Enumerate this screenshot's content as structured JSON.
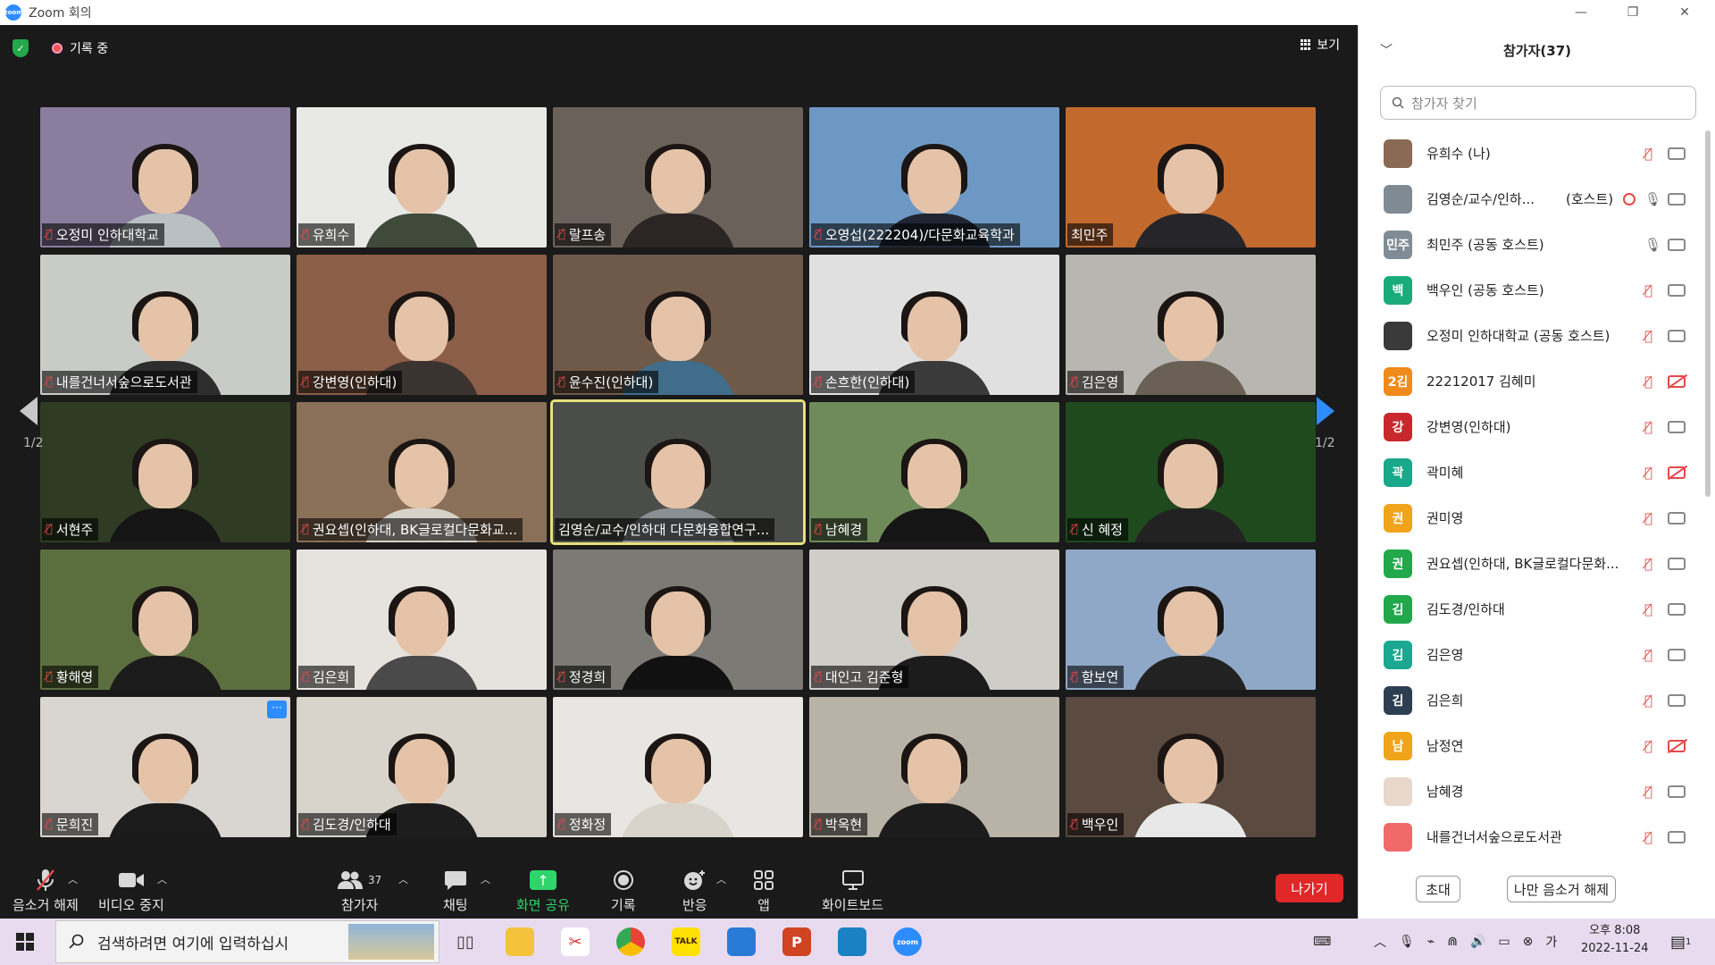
{
  "window": {
    "title": "Zoom 회의",
    "logo_text": "zoom"
  },
  "meeting": {
    "recording_label": "기록 중",
    "view_label": "보기",
    "page_left": "1/2",
    "page_right": "1/2"
  },
  "tiles": [
    {
      "name": "오정미 인하대학교",
      "muted": true,
      "bg": "#8b7d9e",
      "shirt": "#b9c0c4"
    },
    {
      "name": "유희수",
      "muted": true,
      "bg": "#e8e8e6",
      "shirt": "#3f4a3a"
    },
    {
      "name": "랄프송",
      "muted": true,
      "bg": "#6a625a",
      "shirt": "#2b2624"
    },
    {
      "name": "오영섭(222204)/다문화교육학과",
      "muted": true,
      "bg": "#6e98c4",
      "shirt": "#1f2633"
    },
    {
      "name": "최민주",
      "muted": false,
      "bg": "#c26a2e",
      "shirt": "#26262a"
    },
    {
      "name": "내를건너서숲으로도서관",
      "muted": true,
      "bg": "#c9cbc7",
      "shirt": "#2d2d2d"
    },
    {
      "name": "강변영(인하대)",
      "muted": true,
      "bg": "#8b5e48",
      "shirt": "#3b3330"
    },
    {
      "name": "윤수진(인하대)",
      "muted": true,
      "bg": "#6f5a4a",
      "shirt": "#3f6d8a"
    },
    {
      "name": "손흐한(인하대)",
      "muted": true,
      "bg": "#e0e0e0",
      "shirt": "#3a3a3a"
    },
    {
      "name": "김은영",
      "muted": true,
      "bg": "#b8b6b0",
      "shirt": "#6a6055"
    },
    {
      "name": "서현주",
      "muted": true,
      "bg": "#2f3b22",
      "shirt": "#151515"
    },
    {
      "name": "권요셉(인하대, BK글로컬다문화교...",
      "muted": true,
      "bg": "#8a7058",
      "shirt": "#d7d3c8"
    },
    {
      "name": "김영순/교수/인하대 다문화융합연구...",
      "muted": false,
      "bg": "#4b4d49",
      "shirt": "#8a8f93"
    },
    {
      "name": "남혜경",
      "muted": true,
      "bg": "#6f8b5a",
      "shirt": "#151515"
    },
    {
      "name": "신 혜정",
      "muted": true,
      "bg": "#1e4a1e",
      "shirt": "#222222"
    },
    {
      "name": "황해영",
      "muted": true,
      "bg": "#5b6f3e",
      "shirt": "#1b1b1b"
    },
    {
      "name": "김은희",
      "muted": true,
      "bg": "#e6e3de",
      "shirt": "#4a4a4a"
    },
    {
      "name": "정경희",
      "muted": true,
      "bg": "#7c7a74",
      "shirt": "#111111"
    },
    {
      "name": "대인고 김준형",
      "muted": true,
      "bg": "#cfcdc8",
      "shirt": "#1c1c1c"
    },
    {
      "name": "함보연",
      "muted": true,
      "bg": "#8fa8c8",
      "shirt": "#222222"
    },
    {
      "name": "문희진",
      "muted": true,
      "bg": "#d9d6d2",
      "shirt": "#1b1b1b"
    },
    {
      "name": "김도경/인하대",
      "muted": true,
      "bg": "#d8d4cc",
      "shirt": "#1d1d1d"
    },
    {
      "name": "정화정",
      "muted": true,
      "bg": "#e8e6e2",
      "shirt": "#d8d4cc"
    },
    {
      "name": "박옥현",
      "muted": true,
      "bg": "#b9b2a6",
      "shirt": "#1c1c1c"
    },
    {
      "name": "백우인",
      "muted": true,
      "bg": "#5a4a40",
      "shirt": "#e8e8e8"
    }
  ],
  "tile_more_label": "···",
  "toolbar": {
    "unmute": "음소거 해제",
    "stop_video": "비디오 중지",
    "participants": "참가자",
    "participants_count": "37",
    "chat": "채팅",
    "share": "화면 공유",
    "record": "기록",
    "reactions": "반응",
    "apps": "앱",
    "whiteboard": "화이트보드",
    "leave": "나가기"
  },
  "panel": {
    "title": "참가자(37)",
    "search_placeholder": "참가자 찾기",
    "invite": "초대",
    "unmute_me": "나만 음소거 해제",
    "participants": [
      {
        "name": "유희수 (나)",
        "avatar": "",
        "color": "#8a6a55",
        "role": "",
        "mic": "off",
        "cam": "on"
      },
      {
        "name": "김영순/교수/인하...",
        "avatar": "",
        "color": "#7f8a93",
        "role": "(호스트)",
        "mic": "on",
        "cam": "on",
        "rec": true
      },
      {
        "name": "최민주 (공동 호스트)",
        "avatar": "민주",
        "color": "#7f8c95",
        "role": "",
        "mic": "on",
        "cam": "on"
      },
      {
        "name": "백우인 (공동 호스트)",
        "avatar": "백",
        "color": "#1aab7a",
        "role": "",
        "mic": "off",
        "cam": "on"
      },
      {
        "name": "오정미 인하대학교 (공동 호스트)",
        "avatar": "",
        "color": "#3a3a3a",
        "role": "",
        "mic": "off",
        "cam": "on"
      },
      {
        "name": "22212017 김혜미",
        "avatar": "2김",
        "color": "#f08a1a",
        "role": "",
        "mic": "off",
        "cam": "off"
      },
      {
        "name": "강변영(인하대)",
        "avatar": "강",
        "color": "#c8282c",
        "role": "",
        "mic": "off",
        "cam": "on"
      },
      {
        "name": "곽미혜",
        "avatar": "곽",
        "color": "#18a88a",
        "role": "",
        "mic": "off",
        "cam": "off"
      },
      {
        "name": "권미영",
        "avatar": "권",
        "color": "#f0a41a",
        "role": "",
        "mic": "off",
        "cam": "on"
      },
      {
        "name": "권요셉(인하대, BK글로컬다문화...",
        "avatar": "권",
        "color": "#21a84a",
        "role": "",
        "mic": "off",
        "cam": "on"
      },
      {
        "name": "김도경/인하대",
        "avatar": "김",
        "color": "#21a84a",
        "role": "",
        "mic": "off",
        "cam": "on"
      },
      {
        "name": "김은영",
        "avatar": "김",
        "color": "#1aa890",
        "role": "",
        "mic": "off",
        "cam": "on"
      },
      {
        "name": "김은희",
        "avatar": "김",
        "color": "#2c3e50",
        "role": "",
        "mic": "off",
        "cam": "on"
      },
      {
        "name": "남정연",
        "avatar": "남",
        "color": "#f0a41a",
        "role": "",
        "mic": "off",
        "cam": "off"
      },
      {
        "name": "남혜경",
        "avatar": "",
        "color": "#e8d8cc",
        "role": "",
        "mic": "off",
        "cam": "on"
      },
      {
        "name": "내를건너서숲으로도서관",
        "avatar": "",
        "color": "#f06a6a",
        "role": "",
        "mic": "off",
        "cam": "on"
      }
    ]
  },
  "taskbar": {
    "search_placeholder": "검색하려면 여기에 입력하십시",
    "time": "오후 8:08",
    "date": "2022-11-24",
    "notif_count": "1",
    "ime": "가"
  }
}
